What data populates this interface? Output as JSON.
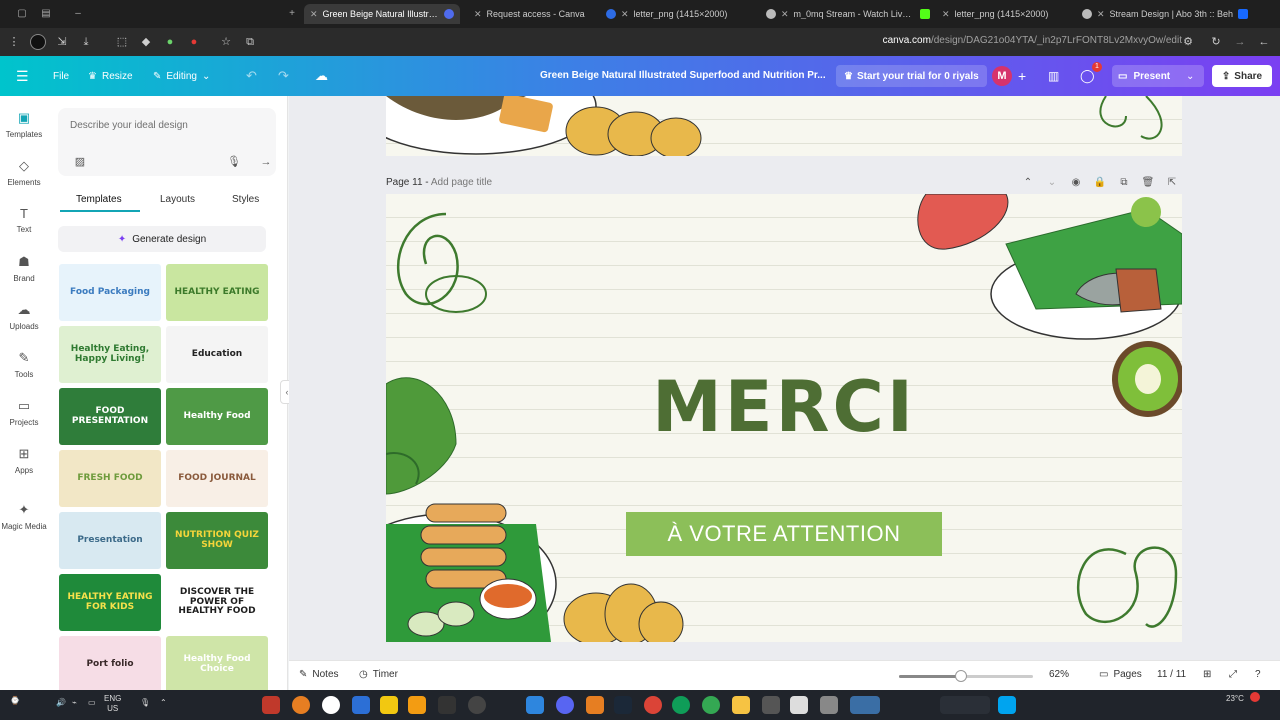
{
  "browser": {
    "tabs": [
      {
        "label": "Green Beige Natural Illustrated",
        "active": true
      },
      {
        "label": "Request access - Canva",
        "active": false
      },
      {
        "label": "letter_png (1415×2000)",
        "active": false
      },
      {
        "label": "m_0mq Stream - Watch Live on",
        "active": false
      },
      {
        "label": "letter_png (1415×2000)",
        "active": false
      },
      {
        "label": "Stream Design | Abo 3th :: Beh",
        "active": false
      }
    ],
    "url_host": "canva.com",
    "url_path": "/design/DAG21o04YTA/_in2p7LrFONT8Lv2MxvyOw/edit"
  },
  "header": {
    "file": "File",
    "resize": "Resize",
    "editing": "Editing",
    "doc_title": "Green Beige Natural Illustrated Superfood and Nutrition Pr...",
    "trial": "Start your trial for 0 riyals",
    "avatar_initial": "M",
    "comment_badge": "1",
    "present": "Present",
    "share": "Share"
  },
  "rail": [
    {
      "label": "Templates",
      "icon": "templates-icon",
      "glyph": "▣"
    },
    {
      "label": "Elements",
      "icon": "elements-icon",
      "glyph": "◇"
    },
    {
      "label": "Text",
      "icon": "text-icon",
      "glyph": "T"
    },
    {
      "label": "Brand",
      "icon": "brand-icon",
      "glyph": "☗"
    },
    {
      "label": "Uploads",
      "icon": "uploads-icon",
      "glyph": "☁"
    },
    {
      "label": "Tools",
      "icon": "tools-icon",
      "glyph": "✎"
    },
    {
      "label": "Projects",
      "icon": "projects-icon",
      "glyph": "▭"
    },
    {
      "label": "Apps",
      "icon": "apps-icon",
      "glyph": "⊞"
    },
    {
      "label": "Magic Media",
      "icon": "magic-media-icon",
      "glyph": "✦"
    }
  ],
  "panel": {
    "prompt_placeholder": "Describe your ideal design",
    "tabs": [
      "Templates",
      "Layouts",
      "Styles"
    ],
    "generate": "Generate design",
    "thumbnails": [
      {
        "text": "Food Packaging",
        "bg": "#e7f3fb",
        "fg": "#3b7bbf"
      },
      {
        "text": "HEALTHY EATING",
        "bg": "#c9e6a0",
        "fg": "#3c7a2a"
      },
      {
        "text": "Healthy Eating, Happy Living!",
        "bg": "#dff0d1",
        "fg": "#2f7a31"
      },
      {
        "text": "Education",
        "bg": "#f4f4f4",
        "fg": "#222222"
      },
      {
        "text": "FOOD PRESENTATION",
        "bg": "#2f7d3a",
        "fg": "#ffffff"
      },
      {
        "text": "Healthy Food",
        "bg": "#4f9a46",
        "fg": "#ffffff"
      },
      {
        "text": "FRESH FOOD",
        "bg": "#f2e7c6",
        "fg": "#6e9b3c"
      },
      {
        "text": "FOOD JOURNAL",
        "bg": "#f8efe6",
        "fg": "#8a5a3c"
      },
      {
        "text": "Presentation",
        "bg": "#d8e9f1",
        "fg": "#3d6b8a"
      },
      {
        "text": "NUTRITION QUIZ SHOW",
        "bg": "#3c8a3a",
        "fg": "#f5d53a"
      },
      {
        "text": "HEALTHY EATING FOR KIDS",
        "bg": "#1f8a3a",
        "fg": "#f7e14b"
      },
      {
        "text": "DISCOVER THE POWER OF HEALTHY FOOD",
        "bg": "#ffffff",
        "fg": "#1e1e1e"
      },
      {
        "text": "Port folio",
        "bg": "#f6dde6",
        "fg": "#3a2a2a"
      },
      {
        "text": "Healthy Food Choice",
        "bg": "#cfe5a8",
        "fg": "#ffffff"
      }
    ]
  },
  "canvas": {
    "page_number": "Page 11",
    "page_title_placeholder": "Add page title",
    "heading": "MERCI",
    "button_text": "À VOTRE ATTENTION"
  },
  "bottom": {
    "notes": "Notes",
    "timer": "Timer",
    "zoom": "62%",
    "zoom_level": 0.46,
    "pages": "Pages",
    "page_count": "11 / 11"
  },
  "taskbar": {
    "lang1": "ENG",
    "lang2": "US",
    "temp": "23°C"
  },
  "colors": {
    "accent": "#13a5b5",
    "merci": "#4e6e34",
    "attention_bg": "#8cbf59"
  }
}
